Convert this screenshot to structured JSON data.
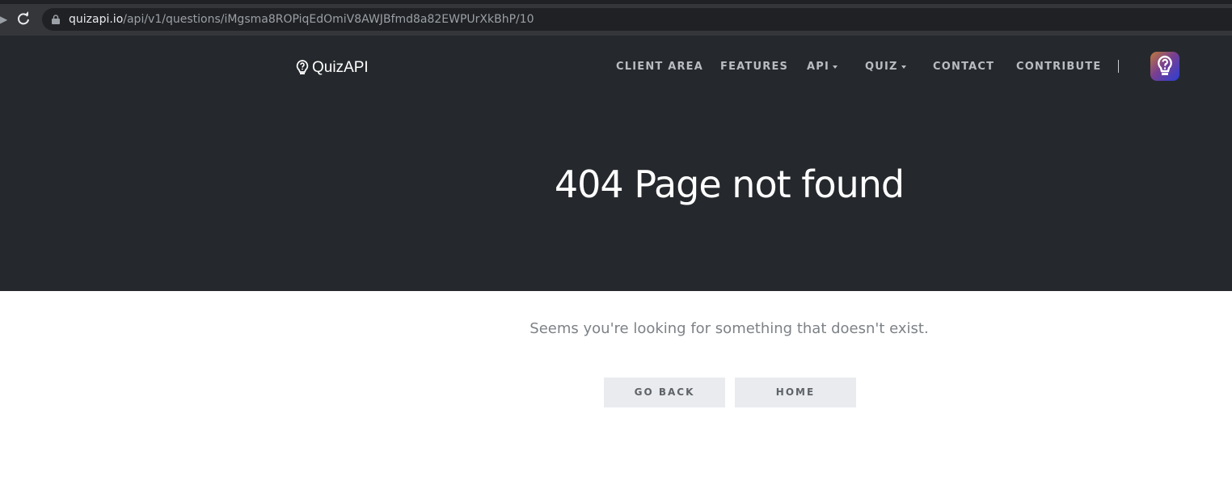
{
  "browser": {
    "url_host": "quizapi.io",
    "url_path": "/api/v1/questions/iMgsma8ROPiqEdOmiV8AWJBfmd8a82EWPUrXkBhP/10"
  },
  "header": {
    "logo_text": "QuizAPI",
    "nav": [
      {
        "label": "CLIENT AREA",
        "dropdown": false
      },
      {
        "label": "FEATURES",
        "dropdown": false
      },
      {
        "label": "API",
        "dropdown": true
      },
      {
        "label": "QUIZ",
        "dropdown": true
      },
      {
        "label": "CONTACT",
        "dropdown": false
      },
      {
        "label": "CONTRIBUTE",
        "dropdown": false
      }
    ],
    "app_icon": "question-bulb-icon"
  },
  "hero": {
    "title": "404 Page not found"
  },
  "content": {
    "message": "Seems you're looking for something that doesn't exist.",
    "go_back_label": "GO BACK",
    "home_label": "HOME"
  },
  "colors": {
    "header_bg": "#25292d",
    "button_bg": "#e9ebee"
  }
}
